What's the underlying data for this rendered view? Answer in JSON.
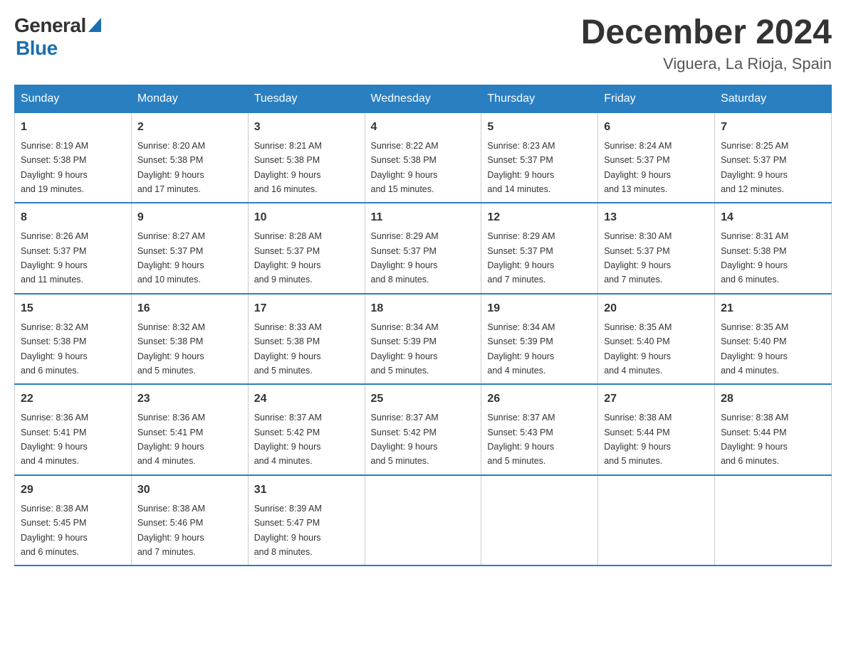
{
  "header": {
    "logo_general": "General",
    "logo_blue": "Blue",
    "month_title": "December 2024",
    "location": "Viguera, La Rioja, Spain"
  },
  "columns": [
    "Sunday",
    "Monday",
    "Tuesday",
    "Wednesday",
    "Thursday",
    "Friday",
    "Saturday"
  ],
  "weeks": [
    [
      {
        "day": "1",
        "sunrise": "8:19 AM",
        "sunset": "5:38 PM",
        "daylight": "9 hours and 19 minutes."
      },
      {
        "day": "2",
        "sunrise": "8:20 AM",
        "sunset": "5:38 PM",
        "daylight": "9 hours and 17 minutes."
      },
      {
        "day": "3",
        "sunrise": "8:21 AM",
        "sunset": "5:38 PM",
        "daylight": "9 hours and 16 minutes."
      },
      {
        "day": "4",
        "sunrise": "8:22 AM",
        "sunset": "5:38 PM",
        "daylight": "9 hours and 15 minutes."
      },
      {
        "day": "5",
        "sunrise": "8:23 AM",
        "sunset": "5:37 PM",
        "daylight": "9 hours and 14 minutes."
      },
      {
        "day": "6",
        "sunrise": "8:24 AM",
        "sunset": "5:37 PM",
        "daylight": "9 hours and 13 minutes."
      },
      {
        "day": "7",
        "sunrise": "8:25 AM",
        "sunset": "5:37 PM",
        "daylight": "9 hours and 12 minutes."
      }
    ],
    [
      {
        "day": "8",
        "sunrise": "8:26 AM",
        "sunset": "5:37 PM",
        "daylight": "9 hours and 11 minutes."
      },
      {
        "day": "9",
        "sunrise": "8:27 AM",
        "sunset": "5:37 PM",
        "daylight": "9 hours and 10 minutes."
      },
      {
        "day": "10",
        "sunrise": "8:28 AM",
        "sunset": "5:37 PM",
        "daylight": "9 hours and 9 minutes."
      },
      {
        "day": "11",
        "sunrise": "8:29 AM",
        "sunset": "5:37 PM",
        "daylight": "9 hours and 8 minutes."
      },
      {
        "day": "12",
        "sunrise": "8:29 AM",
        "sunset": "5:37 PM",
        "daylight": "9 hours and 7 minutes."
      },
      {
        "day": "13",
        "sunrise": "8:30 AM",
        "sunset": "5:37 PM",
        "daylight": "9 hours and 7 minutes."
      },
      {
        "day": "14",
        "sunrise": "8:31 AM",
        "sunset": "5:38 PM",
        "daylight": "9 hours and 6 minutes."
      }
    ],
    [
      {
        "day": "15",
        "sunrise": "8:32 AM",
        "sunset": "5:38 PM",
        "daylight": "9 hours and 6 minutes."
      },
      {
        "day": "16",
        "sunrise": "8:32 AM",
        "sunset": "5:38 PM",
        "daylight": "9 hours and 5 minutes."
      },
      {
        "day": "17",
        "sunrise": "8:33 AM",
        "sunset": "5:38 PM",
        "daylight": "9 hours and 5 minutes."
      },
      {
        "day": "18",
        "sunrise": "8:34 AM",
        "sunset": "5:39 PM",
        "daylight": "9 hours and 5 minutes."
      },
      {
        "day": "19",
        "sunrise": "8:34 AM",
        "sunset": "5:39 PM",
        "daylight": "9 hours and 4 minutes."
      },
      {
        "day": "20",
        "sunrise": "8:35 AM",
        "sunset": "5:40 PM",
        "daylight": "9 hours and 4 minutes."
      },
      {
        "day": "21",
        "sunrise": "8:35 AM",
        "sunset": "5:40 PM",
        "daylight": "9 hours and 4 minutes."
      }
    ],
    [
      {
        "day": "22",
        "sunrise": "8:36 AM",
        "sunset": "5:41 PM",
        "daylight": "9 hours and 4 minutes."
      },
      {
        "day": "23",
        "sunrise": "8:36 AM",
        "sunset": "5:41 PM",
        "daylight": "9 hours and 4 minutes."
      },
      {
        "day": "24",
        "sunrise": "8:37 AM",
        "sunset": "5:42 PM",
        "daylight": "9 hours and 4 minutes."
      },
      {
        "day": "25",
        "sunrise": "8:37 AM",
        "sunset": "5:42 PM",
        "daylight": "9 hours and 5 minutes."
      },
      {
        "day": "26",
        "sunrise": "8:37 AM",
        "sunset": "5:43 PM",
        "daylight": "9 hours and 5 minutes."
      },
      {
        "day": "27",
        "sunrise": "8:38 AM",
        "sunset": "5:44 PM",
        "daylight": "9 hours and 5 minutes."
      },
      {
        "day": "28",
        "sunrise": "8:38 AM",
        "sunset": "5:44 PM",
        "daylight": "9 hours and 6 minutes."
      }
    ],
    [
      {
        "day": "29",
        "sunrise": "8:38 AM",
        "sunset": "5:45 PM",
        "daylight": "9 hours and 6 minutes."
      },
      {
        "day": "30",
        "sunrise": "8:38 AM",
        "sunset": "5:46 PM",
        "daylight": "9 hours and 7 minutes."
      },
      {
        "day": "31",
        "sunrise": "8:39 AM",
        "sunset": "5:47 PM",
        "daylight": "9 hours and 8 minutes."
      },
      null,
      null,
      null,
      null
    ]
  ],
  "labels": {
    "sunrise": "Sunrise:",
    "sunset": "Sunset:",
    "daylight": "Daylight:"
  }
}
